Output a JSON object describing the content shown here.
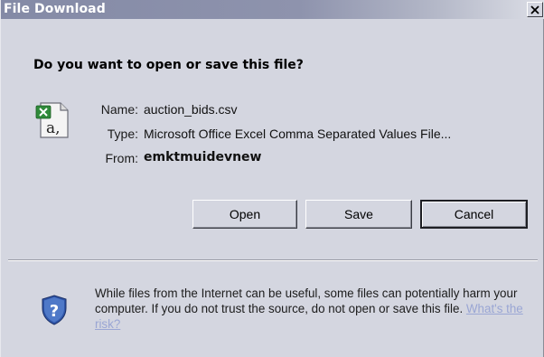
{
  "window": {
    "title": "File Download",
    "close_symbol": "×"
  },
  "prompt": {
    "question": "Do you want to open or save this file?"
  },
  "file": {
    "icon": "excel-csv-file-icon",
    "name_label": "Name:",
    "name_value": "auction_bids.csv",
    "type_label": "Type:",
    "type_value": "Microsoft Office Excel Comma Separated Values File...",
    "from_label": "From:",
    "from_value": "emktmuidevnew"
  },
  "buttons": {
    "open_label": "Open",
    "save_label": "Save",
    "cancel_label": "Cancel"
  },
  "warning": {
    "icon": "security-shield-icon",
    "text": "While files from the Internet can be useful, some files can potentially harm your computer. If you do not trust the source, do not open or save this file.",
    "link_text": "What's the risk?"
  },
  "colors": {
    "dialog_background": "#d4d6e0",
    "titlebar_start": "#848aa6",
    "titlebar_end": "#dcdee6",
    "link": "#9aa6d4",
    "excel_green": "#2f8a3a",
    "shield_blue": "#2f55a8"
  }
}
